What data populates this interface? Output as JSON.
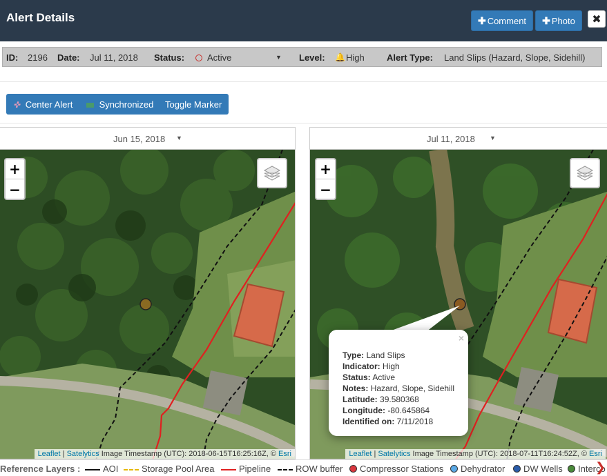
{
  "header": {
    "title": "Alert Details",
    "comment_label": "Comment",
    "photo_label": "Photo",
    "close_label": "✖"
  },
  "info": {
    "id_label": "ID:",
    "id_value": "2196",
    "date_label": "Date:",
    "date_value": "Jul 11, 2018",
    "status_label": "Status:",
    "status_value": "Active",
    "level_label": "Level:",
    "level_value": "High",
    "type_label": "Alert Type:",
    "type_value": "Land Slips (Hazard, Slope, Sidehill)"
  },
  "toolbar": {
    "center_label": "Center Alert",
    "sync_label": "Synchronized",
    "toggle_label": "Toggle Marker"
  },
  "left_map": {
    "date": "Jun 15, 2018",
    "timestamp": "Image Timestamp (UTC): 2018-06-15T16:25:16Z, ©"
  },
  "right_map": {
    "date": "Jul 11, 2018",
    "timestamp": "Image Timestamp (UTC): 2018-07-11T16:24:52Z, ©"
  },
  "attribution": {
    "leaflet": "Leaflet",
    "sep": "|",
    "satelytics": "Satelytics",
    "esri": "Esri"
  },
  "popup": {
    "close": "×",
    "rows": [
      {
        "label": "Type:",
        "value": "Land Slips"
      },
      {
        "label": "Indicator:",
        "value": "High"
      },
      {
        "label": "Status:",
        "value": "Active"
      },
      {
        "label": "Notes:",
        "value": "Hazard, Slope, Sidehill"
      },
      {
        "label": "Latitude:",
        "value": "39.580368"
      },
      {
        "label": "Longitude:",
        "value": "-80.645864"
      },
      {
        "label": "Identified on:",
        "value": "7/11/2018"
      }
    ]
  },
  "legend": {
    "title": "Reference Layers :",
    "aoi": "AOI",
    "storage": "Storage Pool Area",
    "pipeline": "Pipeline",
    "row_buffer": "ROW buffer",
    "compressor": "Compressor Stations",
    "dehydrator": "Dehydrator",
    "dw_wells": "DW Wells",
    "interconnect": "Interco"
  },
  "colors": {
    "header_bg": "#2b3a4b",
    "primary": "#337ab7",
    "pipeline": "#e02020",
    "storage": "#e6b800",
    "compressor": "#d9363e",
    "dehydrator": "#5aa9e6",
    "dw_wells": "#2a5caa",
    "interconnect": "#4a8a3a"
  }
}
